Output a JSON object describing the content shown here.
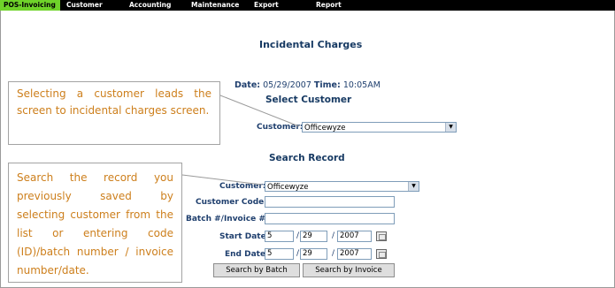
{
  "menu": [
    {
      "label": "POS-Invoicing",
      "active": true
    },
    {
      "label": "Customer"
    },
    {
      "label": "Accounting"
    },
    {
      "label": "Maintenance"
    },
    {
      "label": "Export"
    },
    {
      "label": "Report"
    }
  ],
  "page": {
    "title": "Incidental Charges"
  },
  "datetime": {
    "date_label": "Date:",
    "date": "05/29/2007",
    "time_label": "Time:",
    "time": "10:05AM"
  },
  "select_customer": {
    "heading": "Select Customer",
    "customer_label": "Customer:",
    "customer_value": "Officewyze"
  },
  "search_record": {
    "heading": "Search Record",
    "customer_label": "Customer:",
    "customer_value": "Officewyze",
    "customer_code_label": "Customer Code:",
    "customer_code_value": "",
    "batch_invoice_label": "Batch #/Invoice # :",
    "batch_invoice_value": "",
    "start_date_label": "Start Date:",
    "start_month": "5",
    "start_day": "29",
    "start_year": "2007",
    "end_date_label": "End Date",
    "end_month": "5",
    "end_day": "29",
    "end_year": "2007",
    "date_separator": "/",
    "search_batch_button": "Search by Batch",
    "search_invoice_button": "Search by Invoice"
  },
  "callouts": {
    "select_customer": "Selecting a customer leads the screen to incidental charges screen.",
    "search_record": "Search the record you previously saved by selecting customer from the list or entering code (ID)/batch number / invoice number/date."
  },
  "colors": {
    "menu_bg": "#000000",
    "menu_active": "#6fd32a",
    "heading": "#173a63",
    "callout_text": "#cd7f1c"
  }
}
